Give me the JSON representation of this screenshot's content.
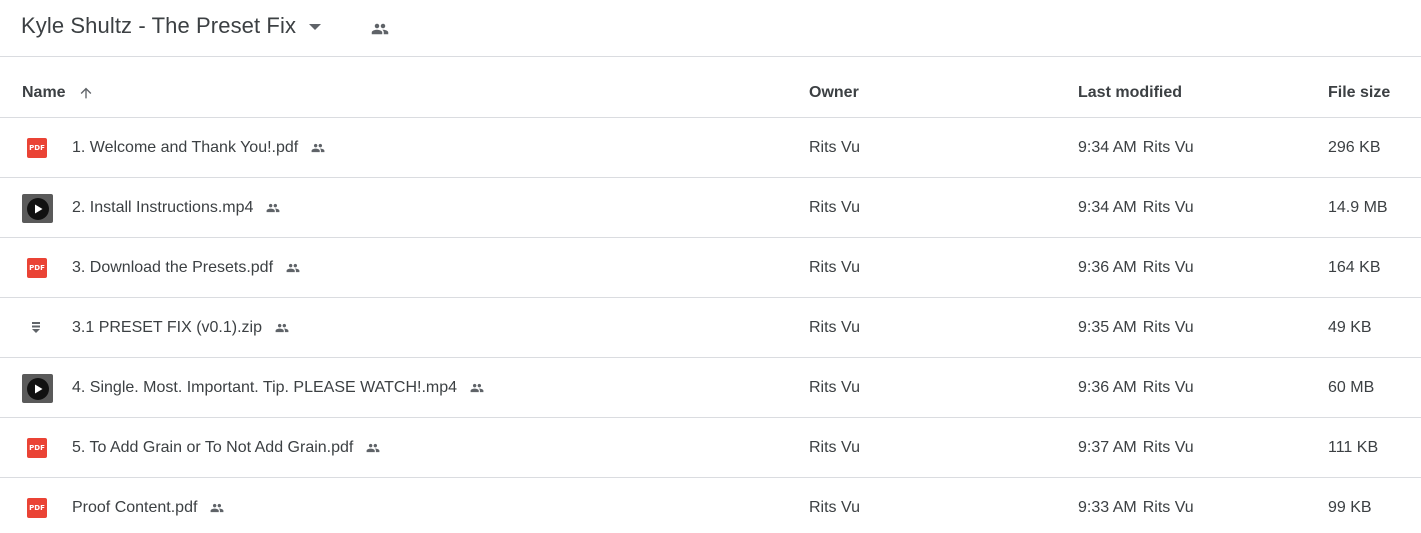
{
  "header": {
    "folder_title": "Kyle Shultz - The Preset Fix",
    "caret_icon": "dropdown-caret-icon",
    "shared_icon": "people-icon"
  },
  "columns": {
    "name": "Name",
    "owner": "Owner",
    "last_modified": "Last modified",
    "file_size": "File size",
    "sort_icon": "arrow-up-icon"
  },
  "colors": {
    "pdf_red": "#ea4335",
    "text": "#3c4043",
    "icon_gray": "#5f6368",
    "divider": "#dadce0"
  },
  "files": [
    {
      "type": "pdf",
      "icon": "pdf-icon",
      "icon_label": "PDF",
      "name": "1. Welcome and Thank You!.pdf",
      "owner": "Rits Vu",
      "time": "9:34 AM",
      "modified_by": "Rits Vu",
      "size": "296 KB"
    },
    {
      "type": "video",
      "icon": "video-thumbnail-icon",
      "name": "2. Install Instructions.mp4",
      "owner": "Rits Vu",
      "time": "9:34 AM",
      "modified_by": "Rits Vu",
      "size": "14.9 MB"
    },
    {
      "type": "pdf",
      "icon": "pdf-icon",
      "icon_label": "PDF",
      "name": "3. Download the Presets.pdf",
      "owner": "Rits Vu",
      "time": "9:36 AM",
      "modified_by": "Rits Vu",
      "size": "164 KB"
    },
    {
      "type": "zip",
      "icon": "zip-icon",
      "name": "3.1 PRESET FIX (v0.1).zip",
      "owner": "Rits Vu",
      "time": "9:35 AM",
      "modified_by": "Rits Vu",
      "size": "49 KB"
    },
    {
      "type": "video",
      "icon": "video-thumbnail-icon",
      "name": "4. Single. Most. Important. Tip. PLEASE WATCH!.mp4",
      "owner": "Rits Vu",
      "time": "9:36 AM",
      "modified_by": "Rits Vu",
      "size": "60 MB"
    },
    {
      "type": "pdf",
      "icon": "pdf-icon",
      "icon_label": "PDF",
      "name": "5. To Add Grain or To Not Add Grain.pdf",
      "owner": "Rits Vu",
      "time": "9:37 AM",
      "modified_by": "Rits Vu",
      "size": "111 KB"
    },
    {
      "type": "pdf",
      "icon": "pdf-icon",
      "icon_label": "PDF",
      "name": "Proof Content.pdf",
      "owner": "Rits Vu",
      "time": "9:33 AM",
      "modified_by": "Rits Vu",
      "size": "99 KB"
    }
  ]
}
